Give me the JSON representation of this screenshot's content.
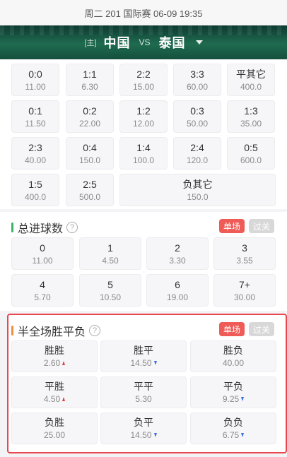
{
  "header": {
    "match_info": "周二 201 国际赛 06-09 19:35"
  },
  "teams": {
    "home_tag": "[主]",
    "home": "中国",
    "vs": "VS",
    "away": "泰国"
  },
  "score_odds": [
    {
      "label": "0:0",
      "odds": "11.00"
    },
    {
      "label": "1:1",
      "odds": "6.30"
    },
    {
      "label": "2:2",
      "odds": "15.00"
    },
    {
      "label": "3:3",
      "odds": "60.00"
    },
    {
      "label": "平其它",
      "odds": "400.0"
    },
    {
      "label": "0:1",
      "odds": "11.50"
    },
    {
      "label": "0:2",
      "odds": "22.00"
    },
    {
      "label": "1:2",
      "odds": "12.00"
    },
    {
      "label": "0:3",
      "odds": "50.00"
    },
    {
      "label": "1:3",
      "odds": "35.00"
    },
    {
      "label": "2:3",
      "odds": "40.00"
    },
    {
      "label": "0:4",
      "odds": "150.0"
    },
    {
      "label": "1:4",
      "odds": "100.0"
    },
    {
      "label": "2:4",
      "odds": "120.0"
    },
    {
      "label": "0:5",
      "odds": "600.0"
    },
    {
      "label": "1:5",
      "odds": "400.0"
    },
    {
      "label": "2:5",
      "odds": "500.0"
    },
    {
      "label": "负其它",
      "odds": "150.0"
    }
  ],
  "total_goals": {
    "title": "总进球数",
    "help": "?",
    "tab_single": "单场",
    "tab_parlay": "过关",
    "items": [
      {
        "label": "0",
        "odds": "11.00"
      },
      {
        "label": "1",
        "odds": "4.50"
      },
      {
        "label": "2",
        "odds": "3.30"
      },
      {
        "label": "3",
        "odds": "3.55"
      },
      {
        "label": "4",
        "odds": "5.70"
      },
      {
        "label": "5",
        "odds": "10.50"
      },
      {
        "label": "6",
        "odds": "19.00"
      },
      {
        "label": "7+",
        "odds": "30.00"
      }
    ]
  },
  "half_full": {
    "title": "半全场胜平负",
    "help": "?",
    "tab_single": "单场",
    "tab_parlay": "过关",
    "items": [
      {
        "label": "胜胜",
        "odds": "2.60",
        "trend": "up"
      },
      {
        "label": "胜平",
        "odds": "14.50",
        "trend": "down"
      },
      {
        "label": "胜负",
        "odds": "40.00",
        "trend": ""
      },
      {
        "label": "平胜",
        "odds": "4.50",
        "trend": "up"
      },
      {
        "label": "平平",
        "odds": "5.30",
        "trend": ""
      },
      {
        "label": "平负",
        "odds": "9.25",
        "trend": "down"
      },
      {
        "label": "负胜",
        "odds": "25.00",
        "trend": ""
      },
      {
        "label": "负平",
        "odds": "14.50",
        "trend": "down"
      },
      {
        "label": "负负",
        "odds": "6.75",
        "trend": "down"
      }
    ]
  },
  "colors": {
    "accent": "#ef5b57",
    "highlight_border": "#e8474f",
    "green_bar": "#3bb36a",
    "orange_bar": "#f0913a",
    "up": "#e53b3b",
    "down": "#3b6fe5"
  }
}
